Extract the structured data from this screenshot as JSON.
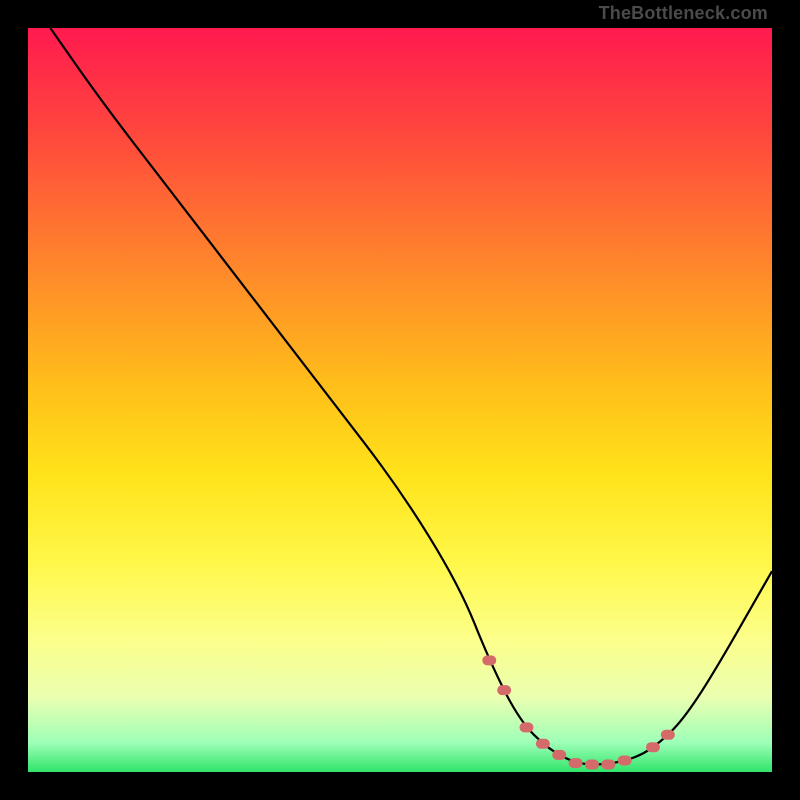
{
  "attribution": "TheBottleneck.com",
  "chart_data": {
    "type": "line",
    "title": "",
    "xlabel": "",
    "ylabel": "",
    "xlim": [
      0,
      100
    ],
    "ylim": [
      0,
      100
    ],
    "series": [
      {
        "name": "bottleneck-curve",
        "x": [
          3,
          10,
          20,
          30,
          40,
          50,
          58,
          62,
          66,
          70,
          74,
          78,
          82,
          85,
          88,
          92,
          100
        ],
        "y": [
          100,
          90,
          77,
          64,
          51,
          38,
          25,
          15,
          7,
          3,
          1,
          1,
          2,
          4,
          7,
          13,
          27
        ]
      }
    ],
    "optimal_zone": {
      "x_start": 62,
      "x_end": 86,
      "marker_color": "#d46a6a"
    },
    "background_gradient": {
      "top": "#ff1a4f",
      "mid": "#ffe31a",
      "bottom": "#30e46a"
    }
  }
}
